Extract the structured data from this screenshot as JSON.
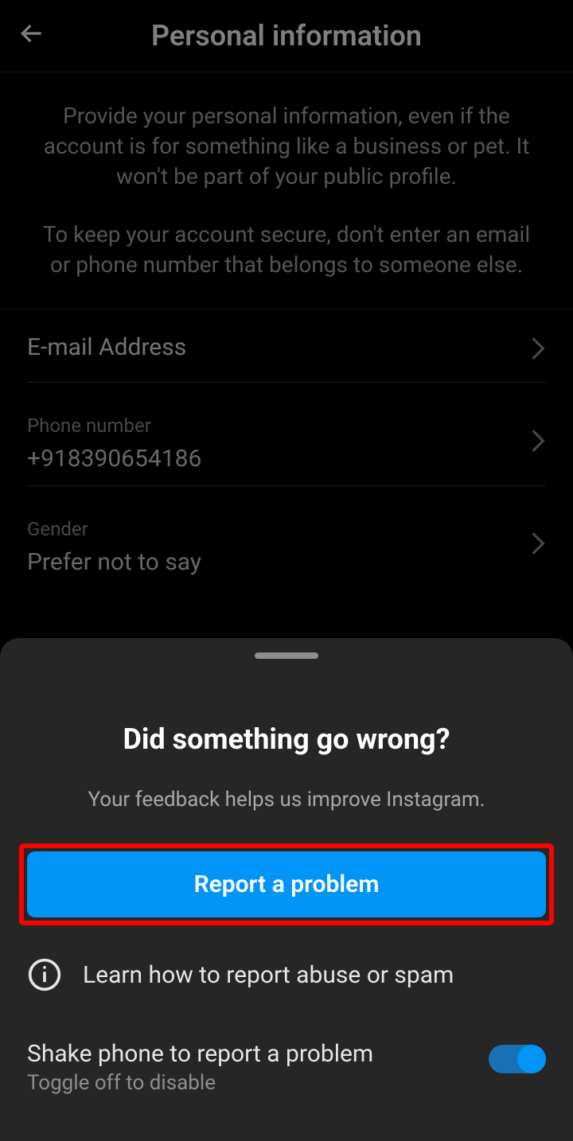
{
  "header": {
    "title": "Personal information"
  },
  "description": {
    "para1": "Provide your personal information, even if the account is for something like a business or pet. It won't be part of your public profile.",
    "para2": "To keep your account secure, don't enter an email or phone number that belongs to someone else."
  },
  "fields": {
    "email": {
      "label": "E-mail Address",
      "value": ""
    },
    "phone": {
      "label": "Phone number",
      "value": "+918390654186"
    },
    "gender": {
      "label": "Gender",
      "value": "Prefer not to say"
    }
  },
  "sheet": {
    "title": "Did something go wrong?",
    "subtitle": "Your feedback helps us improve Instagram.",
    "report_button": "Report a problem",
    "learn_link": "Learn how to report abuse or spam",
    "shake": {
      "title": "Shake phone to report a problem",
      "subtitle": "Toggle off to disable"
    }
  }
}
